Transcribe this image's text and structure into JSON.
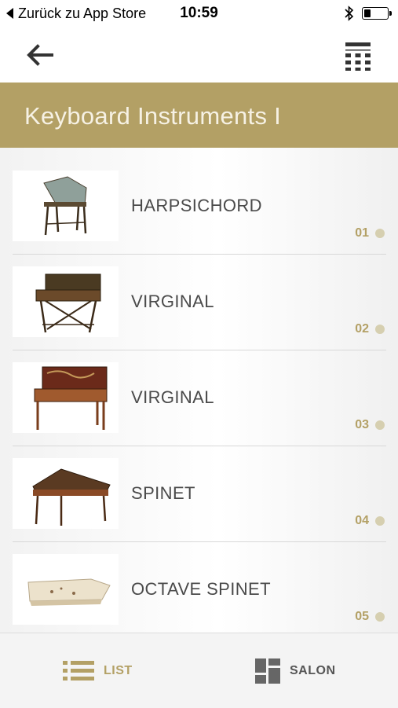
{
  "status_bar": {
    "back_label": "Zurück zu App Store",
    "time": "10:59"
  },
  "nav": {
    "back_icon": "arrow-left-icon",
    "keypad_icon": "keypad-grid-icon"
  },
  "page_title": "Keyboard Instruments I",
  "colors": {
    "accent": "#b3a065",
    "title_text": "#f6f1e4",
    "item_text": "#4a4a4a",
    "dot": "#d6cfb0"
  },
  "items": [
    {
      "label": "HARPSICHORD",
      "number": "01",
      "thumb_icon": "harpsichord-image"
    },
    {
      "label": "VIRGINAL",
      "number": "02",
      "thumb_icon": "virginal-image"
    },
    {
      "label": "VIRGINAL",
      "number": "03",
      "thumb_icon": "virginal-image"
    },
    {
      "label": "SPINET",
      "number": "04",
      "thumb_icon": "spinet-image"
    },
    {
      "label": "OCTAVE SPINET",
      "number": "05",
      "thumb_icon": "octave-spinet-image"
    }
  ],
  "tabs": {
    "list_label": "LIST",
    "salon_label": "SALON",
    "active": "LIST"
  }
}
